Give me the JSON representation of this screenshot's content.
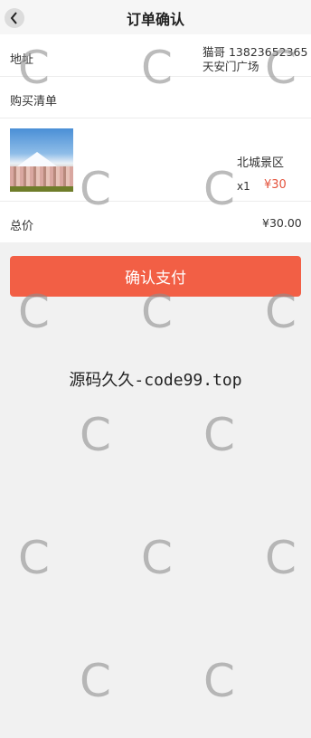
{
  "header": {
    "title": "订单确认",
    "back_icon": "chevron-left-icon"
  },
  "address": {
    "label": "地址",
    "name_phone": "猫哥 13823652365",
    "detail": "天安门广场"
  },
  "cart": {
    "label": "购买清单"
  },
  "product": {
    "name": "北城景区",
    "quantity": "x1",
    "price": "¥30"
  },
  "total": {
    "label": "总价",
    "value": "¥30.00"
  },
  "pay_button": {
    "label": "确认支付"
  },
  "watermark": {
    "text": "源码久久-code99.top",
    "letter": "C"
  },
  "colors": {
    "accent": "#f25f45",
    "price": "#e4533d",
    "background": "#f1f1f1"
  }
}
